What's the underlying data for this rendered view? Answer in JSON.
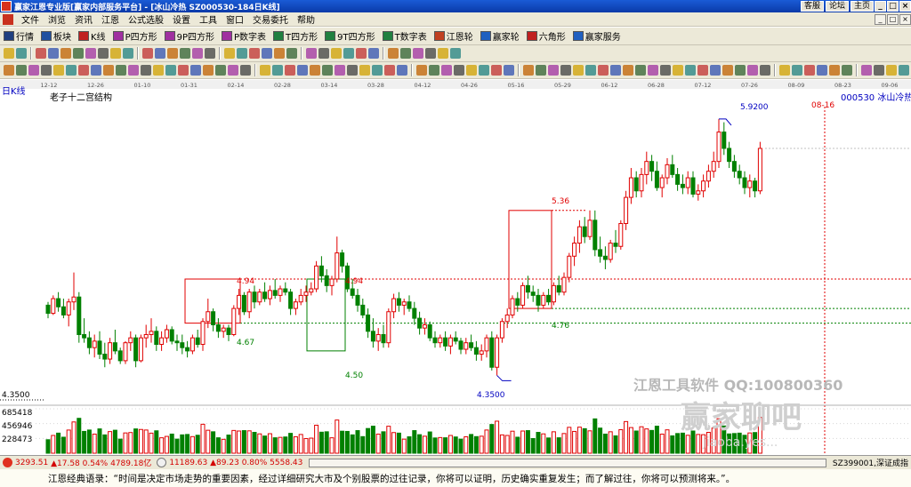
{
  "window": {
    "title": "赢家江恩专业版[赢家内部服务平台] - [冰山冷热   SZ000530-184日K线]",
    "right_buttons": [
      "客服",
      "论坛",
      "主页"
    ],
    "controls": [
      "_",
      "□",
      "×"
    ]
  },
  "menu": {
    "items": [
      "文件",
      "浏览",
      "资讯",
      "江恩",
      "公式选股",
      "设置",
      "工具",
      "窗口",
      "交易委托",
      "帮助"
    ],
    "controls": [
      "_",
      "□",
      "×"
    ]
  },
  "toolbar1": {
    "items": [
      {
        "label": "行情",
        "icon": "grid-icon",
        "color": "#204080"
      },
      {
        "label": "板块",
        "icon": "board-icon",
        "color": "#2050a0"
      },
      {
        "label": "K线",
        "icon": "kline-icon",
        "color": "#c02020"
      },
      {
        "label": "P四方形",
        "icon": "p-square-icon",
        "color": "#a030a0",
        "tag": "P"
      },
      {
        "label": "9P四方形",
        "icon": "9p-square-icon",
        "color": "#a030a0",
        "tag": "9P"
      },
      {
        "label": "P数字表",
        "icon": "p-table-icon",
        "color": "#a030a0",
        "tag": "PN"
      },
      {
        "label": "T四方形",
        "icon": "t-square-icon",
        "color": "#208040",
        "tag": "T"
      },
      {
        "label": "9T四方形",
        "icon": "9t-square-icon",
        "color": "#208040",
        "tag": "9T"
      },
      {
        "label": "T数字表",
        "icon": "t-table-icon",
        "color": "#208040",
        "tag": "TN"
      },
      {
        "label": "江恩轮",
        "icon": "gann-wheel-icon",
        "color": "#c04020"
      },
      {
        "label": "赢家轮",
        "icon": "winner-wheel-icon",
        "color": "#2060c0"
      },
      {
        "label": "六角形",
        "icon": "hexagon-icon",
        "color": "#c02020"
      },
      {
        "label": "赢家服务",
        "icon": "service-icon",
        "color": "#2060c0"
      }
    ]
  },
  "chart": {
    "period_label": "日K线",
    "study_title": "老子十二宫结构",
    "stock_label": "000530 冰山冷热",
    "date_ticks": [
      "12-12",
      "12-26",
      "01-10",
      "01-31",
      "02-14",
      "02-28",
      "03-14",
      "03-28",
      "04-12",
      "04-26",
      "05-16",
      "05-29",
      "06-12",
      "06-28",
      "07-12",
      "07-26",
      "08-09",
      "08-23",
      "09-06"
    ],
    "future_date_label": "08-16",
    "price_labels": {
      "high": "5.9200",
      "low": "4.3500",
      "left_low": "4.3500",
      "box1_top": "4.94",
      "box1_bottom": "4.67",
      "box2_top": "4.94",
      "box2_bottom": "4.50",
      "box3_top": "5.36",
      "box3_bottom": "4.76"
    },
    "volume_labels": [
      "685418",
      "456946",
      "228473"
    ],
    "watermark": {
      "line1": "江恩工具软件  QQ:100800360",
      "line2": "赢家聊吧",
      "line3": "jiaoba.yes..."
    },
    "colors": {
      "up": "#e00000",
      "down": "#008000",
      "box_up": "#e00000",
      "box_down": "#008000",
      "dashed_red": "#e00000",
      "dashed_green": "#008000",
      "annotation": "#0000c0"
    }
  },
  "chart_data": {
    "type": "candlestick",
    "x_axis": "date",
    "y_range": [
      4.2,
      6.05
    ],
    "ohlc": [
      [
        4.78,
        4.8,
        4.7,
        4.73
      ],
      [
        4.73,
        4.84,
        4.72,
        4.82
      ],
      [
        4.82,
        4.86,
        4.74,
        4.77
      ],
      [
        4.77,
        4.82,
        4.7,
        4.72
      ],
      [
        4.72,
        4.82,
        4.65,
        4.8
      ],
      [
        4.8,
        4.98,
        4.75,
        4.83
      ],
      [
        4.83,
        4.86,
        4.55,
        4.6
      ],
      [
        4.6,
        4.7,
        4.55,
        4.58
      ],
      [
        4.58,
        4.62,
        4.48,
        4.52
      ],
      [
        4.52,
        4.6,
        4.46,
        4.56
      ],
      [
        4.56,
        4.62,
        4.45,
        4.48
      ],
      [
        4.48,
        4.55,
        4.4,
        4.45
      ],
      [
        4.45,
        4.58,
        4.42,
        4.55
      ],
      [
        4.55,
        4.63,
        4.48,
        4.5
      ],
      [
        4.5,
        4.52,
        4.42,
        4.44
      ],
      [
        4.44,
        4.56,
        4.42,
        4.55
      ],
      [
        4.55,
        4.62,
        4.5,
        4.58
      ],
      [
        4.58,
        4.6,
        4.4,
        4.44
      ],
      [
        4.44,
        4.6,
        4.43,
        4.58
      ],
      [
        4.58,
        4.66,
        4.52,
        4.6
      ],
      [
        4.6,
        4.7,
        4.55,
        4.62
      ],
      [
        4.62,
        4.65,
        4.5,
        4.54
      ],
      [
        4.54,
        4.62,
        4.5,
        4.58
      ],
      [
        4.58,
        4.66,
        4.55,
        4.63
      ],
      [
        4.63,
        4.65,
        4.54,
        4.56
      ],
      [
        4.56,
        4.6,
        4.5,
        4.55
      ],
      [
        4.55,
        4.6,
        4.48,
        4.52
      ],
      [
        4.52,
        4.56,
        4.46,
        4.5
      ],
      [
        4.5,
        4.6,
        4.48,
        4.58
      ],
      [
        4.58,
        4.63,
        4.52,
        4.54
      ],
      [
        4.54,
        4.7,
        4.5,
        4.68
      ],
      [
        4.68,
        4.82,
        4.64,
        4.74
      ],
      [
        4.74,
        4.76,
        4.62,
        4.66
      ],
      [
        4.66,
        4.7,
        4.58,
        4.62
      ],
      [
        4.62,
        4.66,
        4.58,
        4.64
      ],
      [
        4.64,
        4.66,
        4.56,
        4.6
      ],
      [
        4.6,
        4.78,
        4.59,
        4.76
      ],
      [
        4.76,
        4.88,
        4.72,
        4.84
      ],
      [
        4.84,
        4.86,
        4.72,
        4.74
      ],
      [
        4.74,
        4.88,
        4.7,
        4.86
      ],
      [
        4.86,
        4.9,
        4.76,
        4.8
      ],
      [
        4.8,
        4.88,
        4.78,
        4.86
      ],
      [
        4.86,
        4.92,
        4.8,
        4.82
      ],
      [
        4.82,
        4.9,
        4.78,
        4.87
      ],
      [
        4.87,
        4.94,
        4.82,
        4.84
      ],
      [
        4.84,
        4.9,
        4.8,
        4.88
      ],
      [
        4.88,
        4.92,
        4.84,
        4.86
      ],
      [
        4.86,
        4.88,
        4.72,
        4.76
      ],
      [
        4.76,
        4.82,
        4.72,
        4.8
      ],
      [
        4.8,
        4.88,
        4.78,
        4.84
      ],
      [
        4.84,
        4.9,
        4.8,
        4.86
      ],
      [
        4.86,
        4.92,
        4.84,
        4.88
      ],
      [
        4.88,
        5.05,
        4.86,
        5.02
      ],
      [
        5.02,
        5.08,
        4.92,
        4.96
      ],
      [
        4.96,
        5.0,
        4.86,
        4.9
      ],
      [
        4.9,
        4.96,
        4.84,
        4.94
      ],
      [
        4.94,
        5.2,
        4.92,
        5.1
      ],
      [
        5.1,
        5.12,
        4.98,
        5.02
      ],
      [
        5.02,
        5.04,
        4.86,
        4.88
      ],
      [
        4.88,
        4.94,
        4.82,
        4.84
      ],
      [
        4.84,
        4.88,
        4.74,
        4.78
      ],
      [
        4.78,
        4.82,
        4.7,
        4.72
      ],
      [
        4.72,
        4.76,
        4.58,
        4.62
      ],
      [
        4.62,
        4.7,
        4.52,
        4.56
      ],
      [
        4.56,
        4.64,
        4.5,
        4.6
      ],
      [
        4.6,
        4.66,
        4.52,
        4.55
      ],
      [
        4.55,
        4.76,
        4.52,
        4.74
      ],
      [
        4.74,
        4.85,
        4.7,
        4.82
      ],
      [
        4.82,
        4.86,
        4.74,
        4.78
      ],
      [
        4.78,
        4.82,
        4.72,
        4.8
      ],
      [
        4.8,
        4.84,
        4.74,
        4.76
      ],
      [
        4.76,
        4.8,
        4.66,
        4.7
      ],
      [
        4.7,
        4.74,
        4.6,
        4.64
      ],
      [
        4.64,
        4.7,
        4.6,
        4.66
      ],
      [
        4.66,
        4.68,
        4.56,
        4.58
      ],
      [
        4.58,
        4.62,
        4.52,
        4.55
      ],
      [
        4.55,
        4.6,
        4.52,
        4.58
      ],
      [
        4.58,
        4.62,
        4.5,
        4.53
      ],
      [
        4.53,
        4.6,
        4.48,
        4.58
      ],
      [
        4.58,
        4.62,
        4.54,
        4.56
      ],
      [
        4.56,
        4.58,
        4.48,
        4.51
      ],
      [
        4.51,
        4.58,
        4.48,
        4.55
      ],
      [
        4.55,
        4.6,
        4.5,
        4.52
      ],
      [
        4.52,
        4.56,
        4.44,
        4.48
      ],
      [
        4.48,
        4.54,
        4.44,
        4.5
      ],
      [
        4.5,
        4.6,
        4.46,
        4.58
      ],
      [
        4.58,
        4.62,
        4.38,
        4.4
      ],
      [
        4.4,
        4.6,
        4.35,
        4.58
      ],
      [
        4.58,
        4.7,
        4.55,
        4.68
      ],
      [
        4.68,
        4.76,
        4.64,
        4.72
      ],
      [
        4.72,
        4.84,
        4.7,
        4.82
      ],
      [
        4.82,
        4.86,
        4.74,
        4.78
      ],
      [
        4.78,
        4.92,
        4.76,
        4.9
      ],
      [
        4.9,
        4.96,
        4.82,
        4.86
      ],
      [
        4.86,
        4.9,
        4.8,
        4.84
      ],
      [
        4.84,
        4.88,
        4.74,
        4.78
      ],
      [
        4.78,
        4.86,
        4.76,
        4.84
      ],
      [
        4.84,
        4.88,
        4.78,
        4.8
      ],
      [
        4.8,
        4.92,
        4.78,
        4.9
      ],
      [
        4.9,
        4.96,
        4.84,
        4.86
      ],
      [
        4.86,
        4.98,
        4.84,
        4.95
      ],
      [
        4.95,
        5.1,
        4.92,
        5.08
      ],
      [
        5.08,
        5.2,
        5.02,
        5.16
      ],
      [
        5.16,
        5.3,
        5.1,
        5.26
      ],
      [
        5.26,
        5.32,
        5.16,
        5.2
      ],
      [
        5.2,
        5.36,
        5.18,
        5.3
      ],
      [
        5.3,
        5.36,
        5.08,
        5.12
      ],
      [
        5.12,
        5.2,
        5.04,
        5.08
      ],
      [
        5.08,
        5.14,
        5.0,
        5.06
      ],
      [
        5.06,
        5.18,
        5.04,
        5.16
      ],
      [
        5.16,
        5.24,
        5.1,
        5.14
      ],
      [
        5.14,
        5.3,
        5.12,
        5.28
      ],
      [
        5.28,
        5.48,
        5.24,
        5.44
      ],
      [
        5.44,
        5.62,
        5.4,
        5.56
      ],
      [
        5.56,
        5.6,
        5.44,
        5.48
      ],
      [
        5.48,
        5.62,
        5.44,
        5.58
      ],
      [
        5.58,
        5.72,
        5.52,
        5.66
      ],
      [
        5.66,
        5.7,
        5.54,
        5.6
      ],
      [
        5.6,
        5.66,
        5.48,
        5.5
      ],
      [
        5.5,
        5.58,
        5.44,
        5.56
      ],
      [
        5.56,
        5.68,
        5.52,
        5.64
      ],
      [
        5.64,
        5.7,
        5.56,
        5.58
      ],
      [
        5.58,
        5.62,
        5.48,
        5.52
      ],
      [
        5.52,
        5.58,
        5.46,
        5.5
      ],
      [
        5.5,
        5.6,
        5.46,
        5.56
      ],
      [
        5.56,
        5.6,
        5.44,
        5.46
      ],
      [
        5.46,
        5.52,
        5.42,
        5.48
      ],
      [
        5.48,
        5.58,
        5.44,
        5.54
      ],
      [
        5.54,
        5.64,
        5.5,
        5.6
      ],
      [
        5.6,
        5.72,
        5.56,
        5.66
      ],
      [
        5.66,
        5.92,
        5.62,
        5.84
      ],
      [
        5.84,
        5.9,
        5.7,
        5.74
      ],
      [
        5.74,
        5.78,
        5.62,
        5.66
      ],
      [
        5.66,
        5.7,
        5.56,
        5.6
      ],
      [
        5.6,
        5.64,
        5.52,
        5.56
      ],
      [
        5.56,
        5.6,
        5.46,
        5.5
      ],
      [
        5.5,
        5.58,
        5.44,
        5.54
      ],
      [
        5.54,
        5.56,
        5.44,
        5.48
      ],
      [
        5.48,
        5.78,
        5.46,
        5.74
      ]
    ],
    "volume_ticks": [
      685418,
      456946,
      228473
    ],
    "boxes": [
      {
        "top": 4.94,
        "bottom": 4.67,
        "color": "red"
      },
      {
        "top": 4.94,
        "bottom": 4.5,
        "color": "green"
      },
      {
        "top": 5.36,
        "bottom": 4.76,
        "color": "red"
      }
    ],
    "high_marker": 5.92,
    "low_marker": 4.35
  },
  "statusbar": {
    "sh_index": "3293.51",
    "sh_change": "▲17.58 0.54% 4789.18亿",
    "sz_index": "11189.63",
    "sz_change": "▲89.23 0.80% 5558.43",
    "right_label": "SZ399001,深证成指"
  },
  "quote": {
    "text": "江恩经典语录：“时间是决定市场走势的重要因素，经过详细研究大市及个别股票的过往记录，你将可以证明，历史确实重复发生；而了解过往，你将可以预测将来。”。"
  }
}
